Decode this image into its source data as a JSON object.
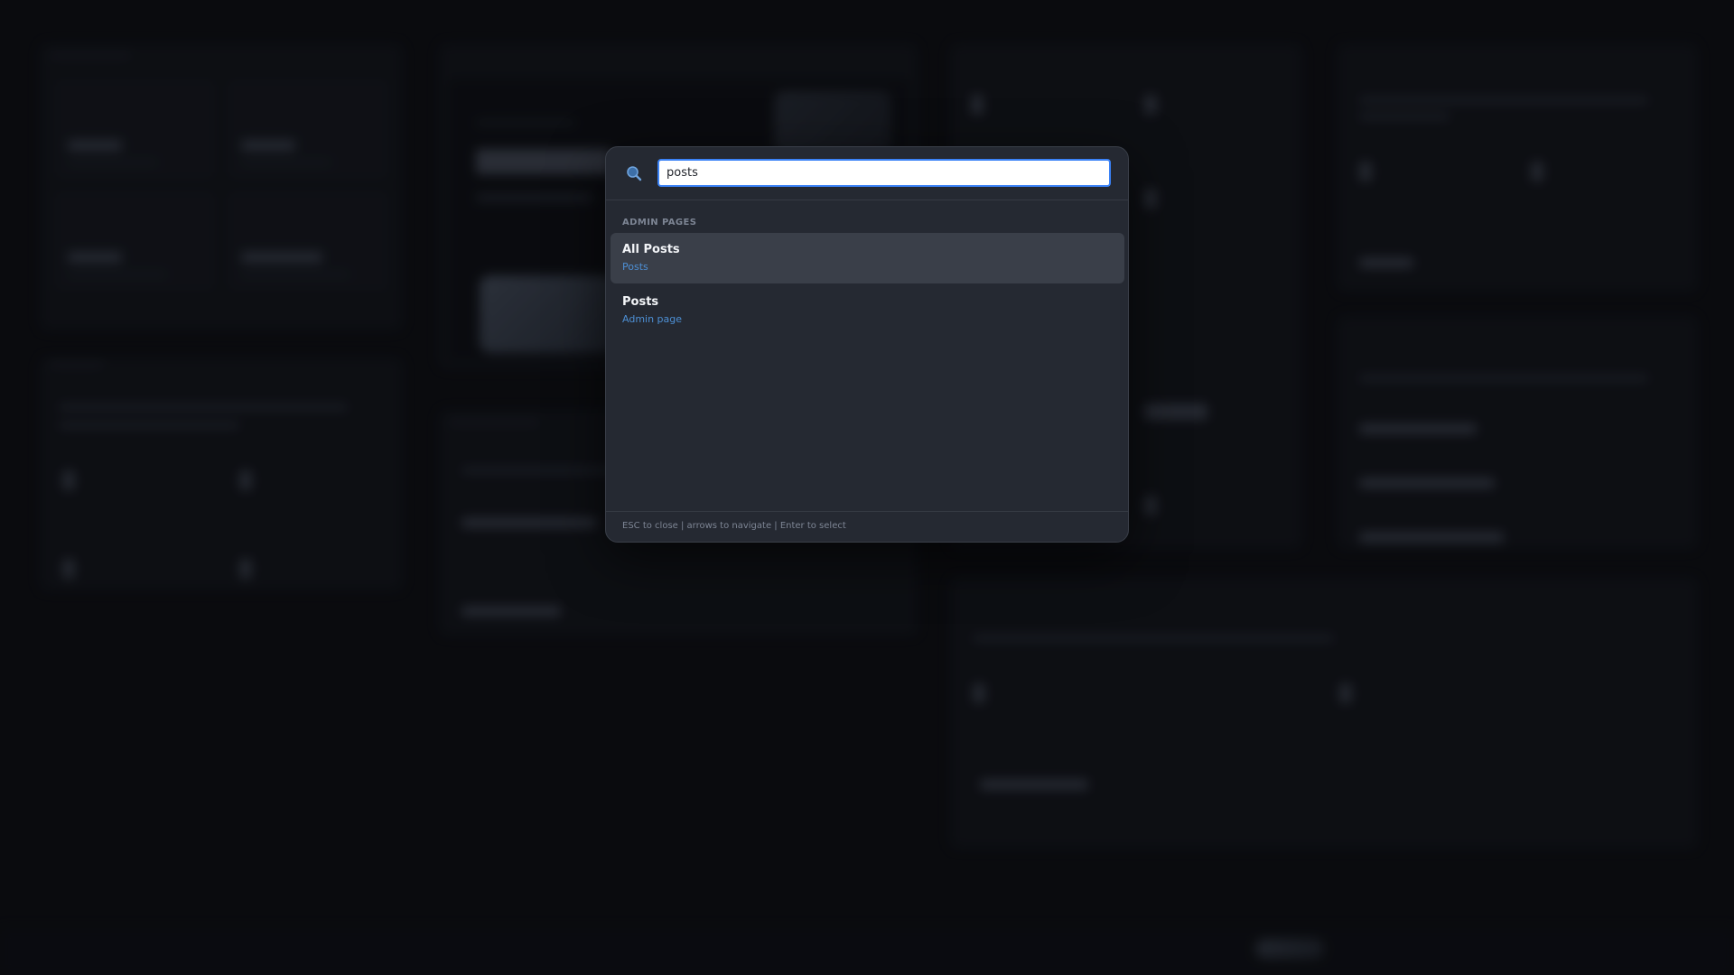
{
  "palette": {
    "search": {
      "value": "posts",
      "placeholder": ""
    },
    "section_label": "ADMIN PAGES",
    "results": [
      {
        "title": "All Posts",
        "subtitle": "Posts",
        "active": true
      },
      {
        "title": "Posts",
        "subtitle": "Admin page",
        "active": false
      }
    ],
    "footer_hint": "ESC to close | arrows to navigate | Enter to select"
  },
  "colors": {
    "accent": "#3b82f6",
    "link": "#4d8fd4",
    "palette_bg": "#252932",
    "backdrop": "#0d0f13"
  },
  "icons": {
    "search": "magnifier-icon"
  }
}
